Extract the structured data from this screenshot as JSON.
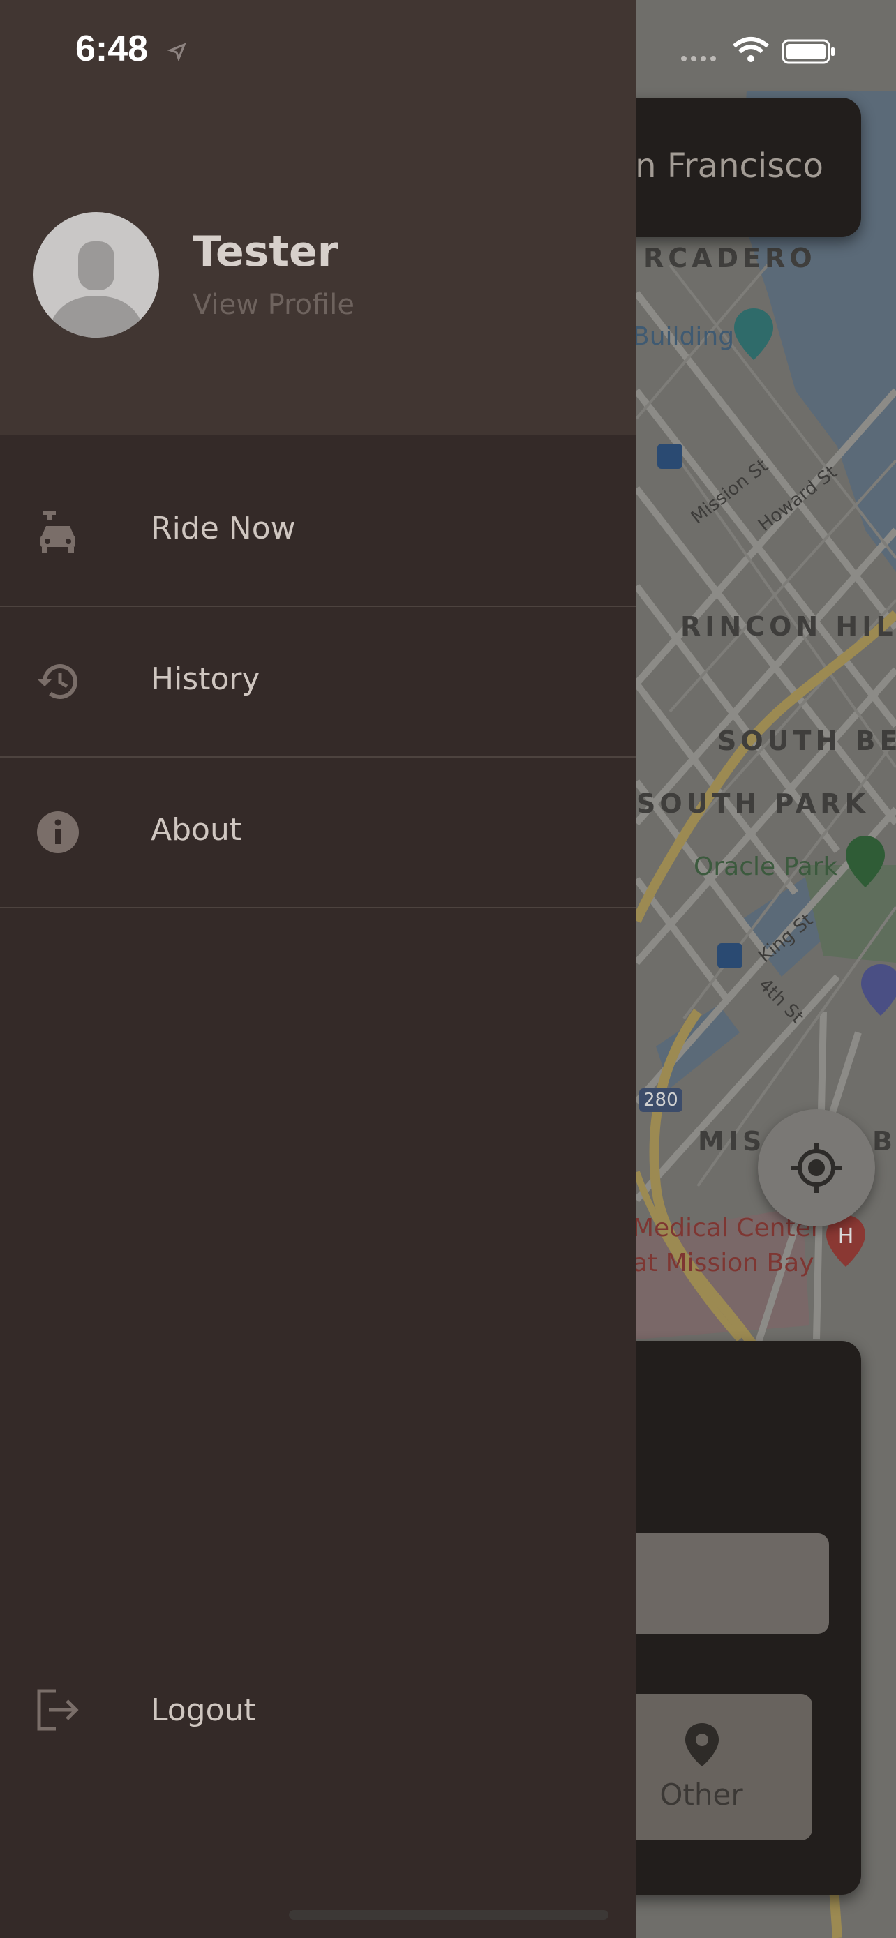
{
  "status_bar": {
    "time": "6:48"
  },
  "drawer": {
    "profile": {
      "name": "Tester",
      "link": "View Profile"
    },
    "menu": [
      {
        "label": "Ride Now",
        "icon": "car-icon"
      },
      {
        "label": "History",
        "icon": "history-icon"
      },
      {
        "label": "About",
        "icon": "info-icon"
      }
    ],
    "logout": {
      "label": "Logout",
      "icon": "logout-icon"
    }
  },
  "map": {
    "search_text": "an Francisco",
    "neighborhoods": [
      "RCADERO",
      "RINCON HIL",
      "SOUTH BE",
      "SOUTH PARK",
      "MIS",
      "B"
    ],
    "pois": [
      "Building",
      "Oracle Park",
      "Medical Center",
      "at Mission Bay"
    ],
    "streets": [
      "Mission St",
      "Howard St",
      "King St",
      "4th St",
      "280"
    ]
  },
  "bottom_panel": {
    "option_label": "Other",
    "option_icon": "location-pin-icon"
  },
  "colors": {
    "drawer_bg": "#342a28",
    "drawer_header_bg": "#413632",
    "map_bg": "#6f6e6a",
    "panel_bg": "#221e1c"
  }
}
